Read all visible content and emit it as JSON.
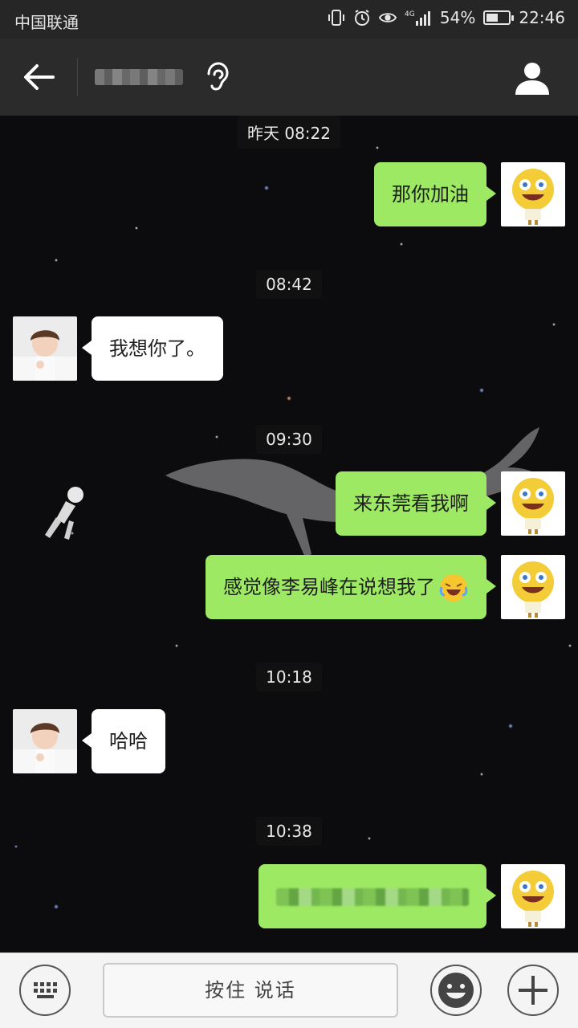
{
  "status_bar": {
    "carrier": "中国联通",
    "network": "4G",
    "battery_percent_text": "54%",
    "battery_level": 0.54,
    "time": "22:46",
    "icons": [
      "vibrate-icon",
      "alarm-icon",
      "eye-comfort-icon",
      "signal-icon",
      "battery-icon"
    ]
  },
  "header": {
    "back_icon": "back-arrow-icon",
    "contact_name_blurred": true,
    "voice_mode_icon": "ear-icon",
    "profile_icon": "person-icon"
  },
  "messages": [
    {
      "type": "time",
      "text": "昨天 08:22"
    },
    {
      "type": "sent",
      "text": "那你加油"
    },
    {
      "type": "time",
      "text": "08:42"
    },
    {
      "type": "received",
      "text": "我想你了。"
    },
    {
      "type": "time",
      "text": "09:30"
    },
    {
      "type": "sent",
      "text": "来东莞看我啊"
    },
    {
      "type": "sent",
      "text": "感觉像李易峰在说想我了",
      "emoji": "laughing-crying-emoji"
    },
    {
      "type": "time",
      "text": "10:18"
    },
    {
      "type": "received",
      "text": "哈哈"
    },
    {
      "type": "time",
      "text": "10:38"
    },
    {
      "type": "sent",
      "text": "",
      "blurred": true
    }
  ],
  "input_bar": {
    "keyboard_icon": "keyboard-icon",
    "hold_to_talk_label": "按住 说话",
    "emoji_icon": "smiley-icon",
    "more_icon": "plus-icon"
  }
}
